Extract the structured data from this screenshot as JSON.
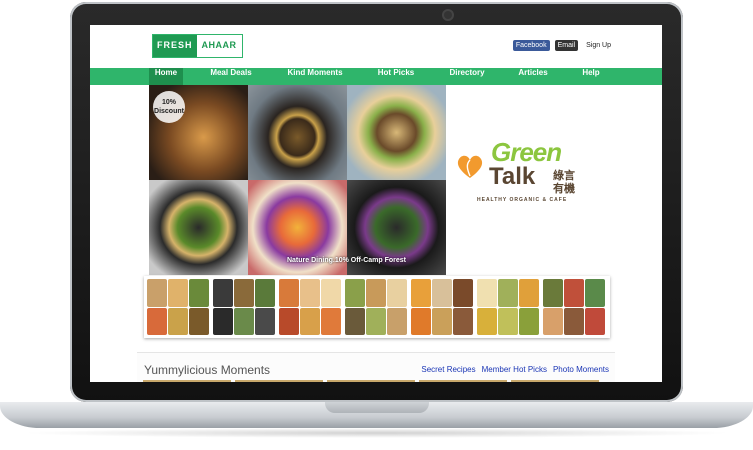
{
  "site": {
    "logo_part1": "FRESH",
    "logo_part2": "AHAAR",
    "top_buttons": {
      "facebook": "Facebook",
      "email": "Email",
      "signup": "Sign Up"
    }
  },
  "nav": [
    "Home",
    "Meal Deals",
    "Kind Moments",
    "Hot Picks",
    "Directory",
    "Articles",
    "Help"
  ],
  "hero": {
    "discount_badge": "10% Discount",
    "caption": "Nature Dining.10% Off-Camp Forest"
  },
  "brand_logo": {
    "word1": "Green",
    "word2": "Talk",
    "chinese1": "綠言",
    "chinese2": "有機",
    "subtitle": "HEALTHY ORGANIC & CAFE"
  },
  "moments": {
    "title": "Yummylicious Moments",
    "links": [
      "Secret Recipes",
      "Member Hot Picks",
      "Photo Moments"
    ]
  },
  "colors": {
    "brand_green": "#2fb56b",
    "nav_active": "#1e8f4e",
    "link_blue": "#1a35b5"
  }
}
